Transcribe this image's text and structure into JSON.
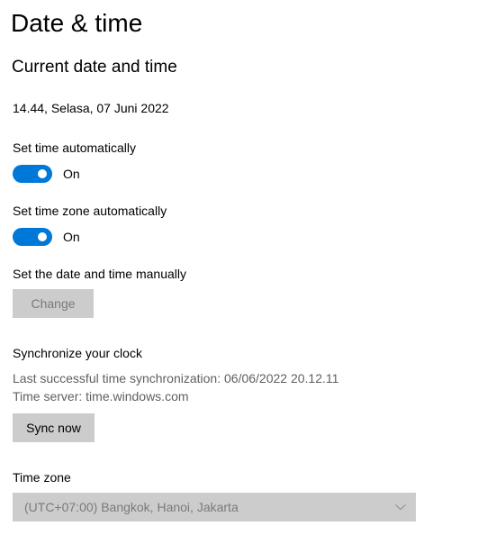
{
  "page": {
    "title": "Date & time",
    "section_title": "Current date and time",
    "current_datetime": "14.44, Selasa, 07 Juni 2022"
  },
  "auto_time": {
    "label": "Set time automatically",
    "state_label": "On",
    "on": true
  },
  "auto_timezone": {
    "label": "Set time zone automatically",
    "state_label": "On",
    "on": true
  },
  "manual": {
    "label": "Set the date and time manually",
    "button_label": "Change",
    "button_enabled": false
  },
  "sync": {
    "label": "Synchronize your clock",
    "last_sync": "Last successful time synchronization: 06/06/2022 20.12.11",
    "time_server": "Time server: time.windows.com",
    "button_label": "Sync now"
  },
  "timezone": {
    "label": "Time zone",
    "selected": "(UTC+07:00) Bangkok, Hanoi, Jakarta",
    "enabled": false
  },
  "colors": {
    "accent": "#0078d7",
    "button_bg": "#cccccc",
    "disabled_text": "#7a7a7a",
    "muted_text": "#5f5f5f"
  },
  "icons": {
    "dropdown": "chevron-down-icon"
  }
}
